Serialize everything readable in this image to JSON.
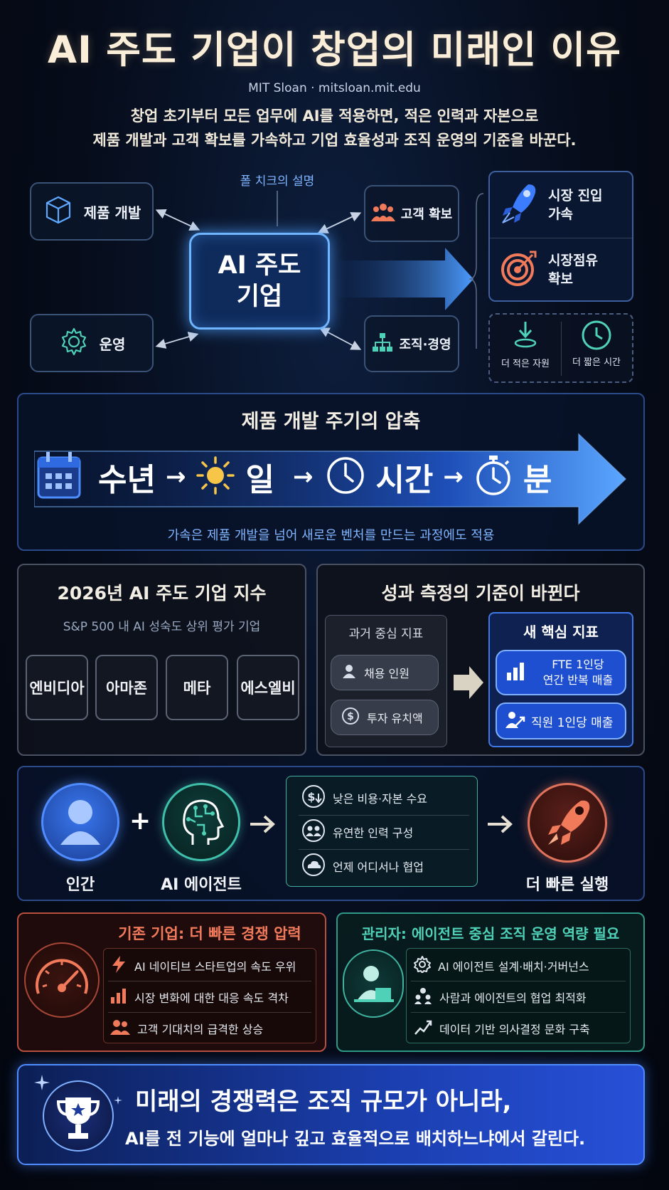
{
  "header": {
    "title": "AI 주도 기업이 창업의 미래인 이유",
    "source": "MIT Sloan · mitsloan.mit.edu",
    "subtitle_line1": "창업 초기부터 모든 업무에 AI를 적용하면, 적은 인력과 자본으로",
    "subtitle_line2": "제품 개발과 고객 확보를 가속하고 기업 효율성과 조직 운영의 기준을 바꾼다."
  },
  "hub": {
    "caption": "폴 치크의 설명",
    "center_line1": "AI 주도",
    "center_line2": "기업",
    "nodes": {
      "product": "제품 개발",
      "customer": "고객 확보",
      "operations": "운영",
      "organization": "조직·경영"
    },
    "results": {
      "market_entry_line1": "시장 진입",
      "market_entry_line2": "가속",
      "market_share_line1": "시장점유",
      "market_share_line2": "확보",
      "fewer_resources": "더 적은 자원",
      "shorter_time": "더 짧은 시간"
    }
  },
  "cycle": {
    "title": "제품 개발 주기의 압축",
    "steps": [
      "수년",
      "일",
      "시간",
      "분"
    ],
    "arrow": "→",
    "caption": "가속은 제품 개발을 넘어 새로운 벤처를 만드는 과정에도 적용"
  },
  "index": {
    "title": "2026년 AI 주도 기업 지수",
    "subtitle": "S&P 500 내 AI 성숙도 상위 평가 기업",
    "companies": [
      "엔비디아",
      "아마존",
      "메타",
      "에스엘비"
    ]
  },
  "metrics": {
    "title": "성과 측정의 기준이 바뀐다",
    "old_header": "과거 중심 지표",
    "old_items": [
      "채용 인원",
      "투자 유치액"
    ],
    "new_header": "새 핵심 지표",
    "new_item1_line1": "FTE 1인당",
    "new_item1_line2": "연간 반복 매출",
    "new_item2": "직원 1인당 매출"
  },
  "combo": {
    "human": "인간",
    "plus": "+",
    "agent": "AI 에이전트",
    "benefits": [
      "낮은 비용·자본 수요",
      "유연한 인력 구성",
      "언제 어디서나 협업"
    ],
    "result": "더 빠른 실행"
  },
  "incumbents": {
    "title": "기존 기업: 더 빠른 경쟁 압력",
    "items": [
      "AI 네이티브 스타트업의 속도 우위",
      "시장 변화에 대한 대응 속도 격차",
      "고객 기대치의 급격한 상승"
    ]
  },
  "managers": {
    "title": "관리자: 에이전트 중심 조직 운영 역량 필요",
    "items": [
      "AI 에이전트 설계·배치·거버넌스",
      "사람과 에이전트의 협업 최적화",
      "데이터 기반 의사결정 문화 구축"
    ]
  },
  "conclusion": {
    "line1": "미래의 경쟁력은 조직 규모가 아니라,",
    "line2": "AI를 전 기능에 얼마나 깊고 효율적으로 배치하느냐에서 갈린다."
  },
  "colors": {
    "accent_blue": "#2f7bff",
    "incumbent_red": "#e0735c",
    "manager_teal": "#4fd1b8",
    "title_cream": "#fbeed8"
  }
}
